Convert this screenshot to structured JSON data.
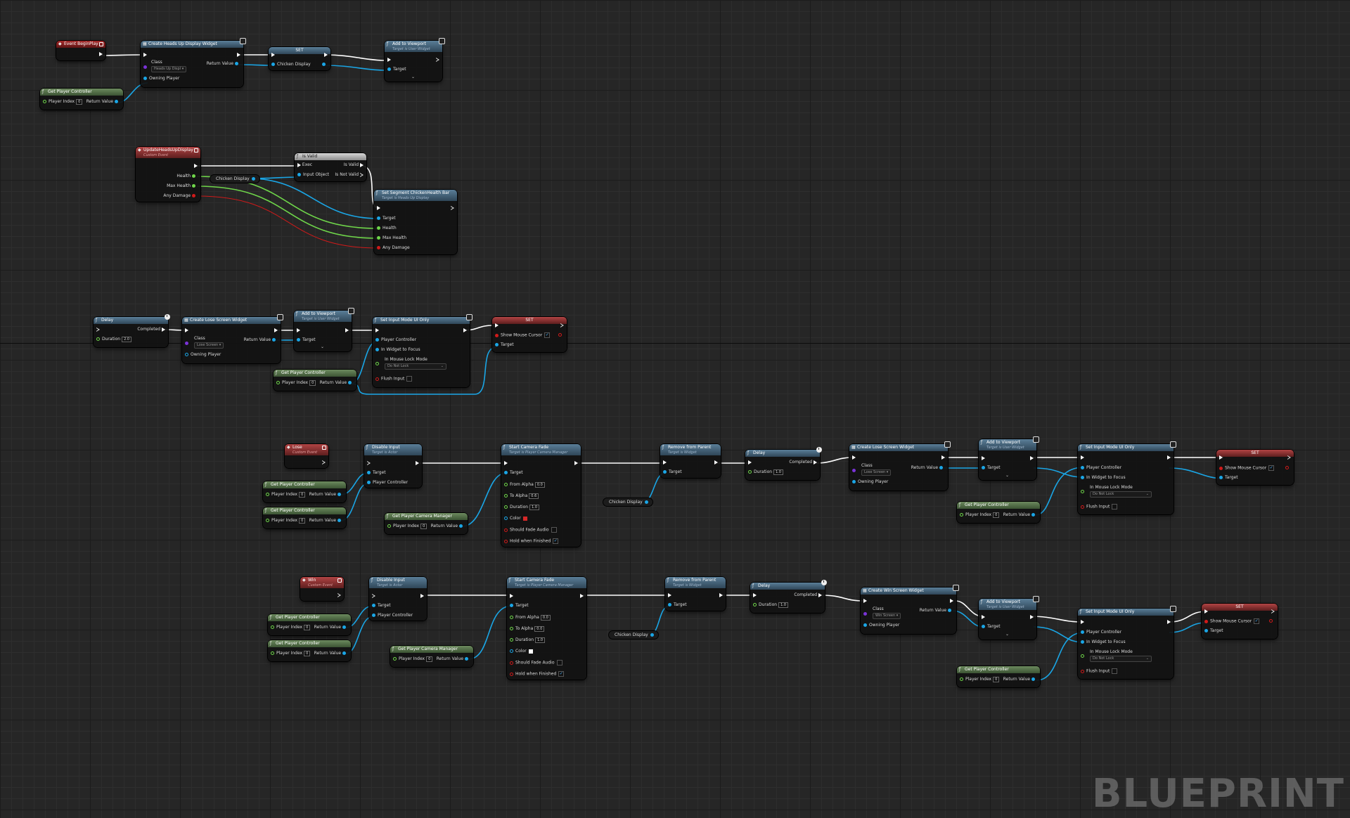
{
  "watermark": "BLUEPRINT",
  "colors": {
    "exec": "#ffffff",
    "object": "#1aa6e6",
    "float": "#6fd64a",
    "int": "#1cbfa0",
    "bool": "#d01a1a",
    "class": "#7a33d8"
  },
  "graph1": {
    "event_begin": "Event BeginPlay",
    "create_hud": {
      "title": "Create Heads Up Display Widget",
      "class_label": "Class",
      "class_value": "Heads Up Displ",
      "owning_player": "Owning Player",
      "return_value": "Return Value"
    },
    "set_node": {
      "title": "SET",
      "var": "Chicken Display"
    },
    "add_viewport": {
      "title": "Add to Viewport",
      "subtitle": "Target is User Widget",
      "target": "Target"
    },
    "get_pc": {
      "title": "Get Player Controller",
      "player_index": "Player Index",
      "index_value": "0",
      "return_value": "Return Value"
    }
  },
  "graph2": {
    "event": {
      "title": "UpdateHeadsUpDisplay",
      "subtitle": "Custom Event",
      "health": "Health",
      "max_health": "Max Health",
      "any_damage": "Any Damage"
    },
    "chicken_var": "Chicken Display",
    "is_valid": {
      "title": "Is Valid",
      "exec": "Exec",
      "input_object": "Input Object",
      "is_valid": "Is Valid",
      "is_not_valid": "Is Not Valid"
    },
    "set_segment": {
      "title": "Set Segment ChickenHealth Bar",
      "subtitle": "Target is Heads Up Display",
      "target": "Target",
      "health": "Health",
      "max_health": "Max Health",
      "any_damage": "Any Damage"
    }
  },
  "graph3": {
    "delay": {
      "title": "Delay",
      "completed": "Completed",
      "duration": "Duration",
      "duration_value": "2.0"
    },
    "create_lose": {
      "title": "Create Lose Screen Widget",
      "class_label": "Class",
      "class_value": "Lose Screen",
      "owning_player": "Owning Player",
      "return_value": "Return Value"
    },
    "add_viewport": {
      "title": "Add to Viewport",
      "subtitle": "Target is User Widget",
      "target": "Target"
    },
    "set_input": {
      "title": "Set Input Mode UI Only",
      "player_controller": "Player Controller",
      "widget_focus": "In Widget to Focus",
      "mouse_lock": "In Mouse Lock Mode",
      "mouse_lock_value": "Do Not Lock",
      "flush": "Flush Input"
    },
    "set_node": {
      "title": "SET",
      "show_cursor": "Show Mouse Cursor",
      "target": "Target"
    },
    "get_pc": {
      "title": "Get Player Controller",
      "player_index": "Player Index",
      "index_value": "0",
      "return_value": "Return Value"
    }
  },
  "graph4": {
    "event": {
      "title": "Lose",
      "subtitle": "Custom Event"
    },
    "disable_input": {
      "title": "Disable Input",
      "subtitle": "Target is Actor",
      "target": "Target",
      "player_controller": "Player Controller"
    },
    "get_pc_a": {
      "title": "Get Player Controller",
      "player_index": "Player Index",
      "index_value": "0",
      "return_value": "Return Value"
    },
    "get_pc_b": {
      "title": "Get Player Controller",
      "player_index": "Player Index",
      "index_value": "0",
      "return_value": "Return Value"
    },
    "get_cam": {
      "title": "Get Player Camera Manager",
      "player_index": "Player Index",
      "index_value": "0",
      "return_value": "Return Value"
    },
    "fade": {
      "title": "Start Camera Fade",
      "subtitle": "Target is Player Camera Manager",
      "target": "Target",
      "from_alpha": "From Alpha",
      "from_value": "0.0",
      "to_alpha": "To Alpha",
      "to_value": "0.6",
      "duration": "Duration",
      "duration_value": "1.0",
      "color": "Color",
      "color_value": "#d62828",
      "fade_audio": "Should Fade Audio",
      "hold": "Hold when Finished"
    },
    "chicken_var": "Chicken Display",
    "remove": {
      "title": "Remove from Parent",
      "subtitle": "Target is Widget",
      "target": "Target"
    },
    "delay": {
      "title": "Delay",
      "completed": "Completed",
      "duration": "Duration",
      "duration_value": "1.0"
    },
    "create_widget": {
      "title": "Create Lose Screen Widget",
      "class_label": "Class",
      "class_value": "Lose Screen",
      "owning_player": "Owning Player",
      "return_value": "Return Value"
    },
    "add_viewport": {
      "title": "Add to Viewport",
      "subtitle": "Target is User Widget",
      "target": "Target"
    },
    "set_input": {
      "title": "Set Input Mode UI Only",
      "player_controller": "Player Controller",
      "widget_focus": "In Widget to Focus",
      "mouse_lock": "In Mouse Lock Mode",
      "mouse_lock_value": "Do Not Lock",
      "flush": "Flush Input"
    },
    "get_pc_c": {
      "title": "Get Player Controller",
      "player_index": "Player Index",
      "index_value": "0",
      "return_value": "Return Value"
    },
    "set_node": {
      "title": "SET",
      "show_cursor": "Show Mouse Cursor",
      "target": "Target"
    }
  },
  "graph5": {
    "event": {
      "title": "Win",
      "subtitle": "Custom Event"
    },
    "disable_input": {
      "title": "Disable Input",
      "subtitle": "Target is Actor",
      "target": "Target",
      "player_controller": "Player Controller"
    },
    "get_pc_a": {
      "title": "Get Player Controller",
      "player_index": "Player Index",
      "index_value": "0",
      "return_value": "Return Value"
    },
    "get_pc_b": {
      "title": "Get Player Controller",
      "player_index": "Player Index",
      "index_value": "0",
      "return_value": "Return Value"
    },
    "get_cam": {
      "title": "Get Player Camera Manager",
      "player_index": "Player Index",
      "index_value": "0",
      "return_value": "Return Value"
    },
    "fade": {
      "title": "Start Camera Fade",
      "subtitle": "Target is Player Camera Manager",
      "target": "Target",
      "from_alpha": "From Alpha",
      "from_value": "0.0",
      "to_alpha": "To Alpha",
      "to_value": "0.0",
      "duration": "Duration",
      "duration_value": "1.0",
      "color": "Color",
      "color_value": "#ffffff",
      "fade_audio": "Should Fade Audio",
      "hold": "Hold when Finished"
    },
    "chicken_var": "Chicken Display",
    "remove": {
      "title": "Remove from Parent",
      "subtitle": "Target is Widget",
      "target": "Target"
    },
    "delay": {
      "title": "Delay",
      "completed": "Completed",
      "duration": "Duration",
      "duration_value": "1.0"
    },
    "create_widget": {
      "title": "Create Win Screen Widget",
      "class_label": "Class",
      "class_value": "Win Screen",
      "owning_player": "Owning Player",
      "return_value": "Return Value"
    },
    "add_viewport": {
      "title": "Add to Viewport",
      "subtitle": "Target is User Widget",
      "target": "Target"
    },
    "set_input": {
      "title": "Set Input Mode UI Only",
      "player_controller": "Player Controller",
      "widget_focus": "In Widget to Focus",
      "mouse_lock": "In Mouse Lock Mode",
      "mouse_lock_value": "Do Not Lock",
      "flush": "Flush Input"
    },
    "get_pc_c": {
      "title": "Get Player Controller",
      "player_index": "Player Index",
      "index_value": "0",
      "return_value": "Return Value"
    },
    "set_node": {
      "title": "SET",
      "show_cursor": "Show Mouse Cursor",
      "target": "Target"
    }
  }
}
